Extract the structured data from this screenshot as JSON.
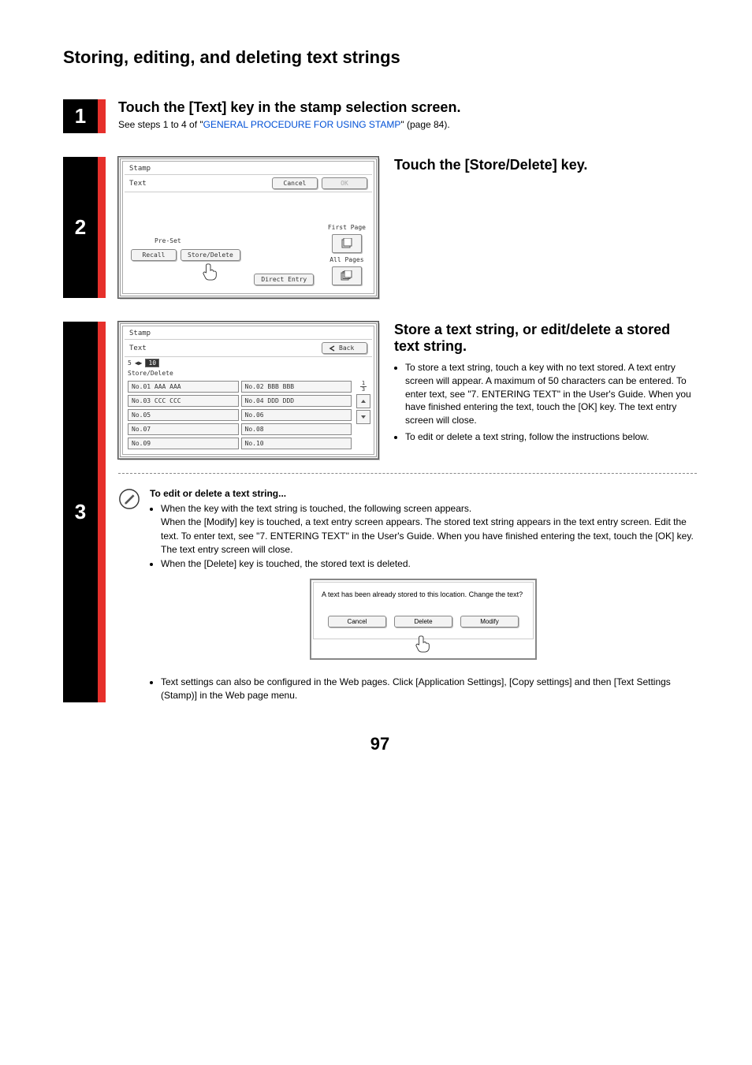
{
  "page": {
    "title": "Storing, editing, and deleting text strings",
    "number": "97"
  },
  "step1": {
    "num": "1",
    "heading": "Touch the [Text] key in the stamp selection screen.",
    "line_prefix": "See steps 1 to 4 of \"",
    "link": "GENERAL PROCEDURE FOR USING STAMP",
    "line_suffix": "\" (page 84)."
  },
  "step2": {
    "num": "2",
    "heading": "Touch the [Store/Delete] key.",
    "panel": {
      "crumb": "Stamp",
      "subtitle": "Text",
      "cancel": "Cancel",
      "ok": "OK",
      "preset": "Pre-Set",
      "recall": "Recall",
      "store_delete": "Store/Delete",
      "direct_entry": "Direct Entry",
      "first_page": "First Page",
      "all_pages": "All Pages"
    }
  },
  "step3": {
    "num": "3",
    "heading": "Store a text string, or edit/delete a stored text string.",
    "bullets": [
      "To store a text string, touch a key with no text stored. A text entry screen will appear. A maximum of 50 characters can be entered. To enter text, see \"7. ENTERING TEXT\" in the User's Guide. When you have finished entering the text, touch the [OK] key. The text entry screen will close.",
      "To edit or delete a text string, follow the instructions below."
    ],
    "listpanel": {
      "crumb": "Stamp",
      "subtitle": "Text",
      "back": "Back",
      "counter_left": "5",
      "counter_right": "10",
      "store_delete": "Store/Delete",
      "frac_top": "1",
      "frac_bot": "3",
      "items": [
        "No.01 AAA AAA",
        "No.02 BBB BBB",
        "No.03 CCC CCC",
        "No.04 DDD DDD",
        "No.05",
        "No.06",
        "No.07",
        "No.08",
        "No.09",
        "No.10"
      ]
    },
    "note": {
      "title": "To edit or delete a text string...",
      "b1": "When the key with the text string is touched, the following screen appears.",
      "b1b": "When the [Modify] key is touched, a text entry screen appears. The stored text string appears in the text entry screen. Edit the text. To enter text, see \"7. ENTERING TEXT\" in the User's Guide. When you have finished entering the text, touch the [OK] key. The text entry screen will close.",
      "b2": "When the [Delete] key is touched, the stored text is deleted.",
      "dialog": {
        "msg": "A text has been already stored to this location. Change the text?",
        "cancel": "Cancel",
        "delete": "Delete",
        "modify": "Modify"
      },
      "foot": "Text settings can also be configured in the Web pages. Click [Application Settings], [Copy settings] and then [Text Settings (Stamp)] in the Web page menu."
    }
  }
}
